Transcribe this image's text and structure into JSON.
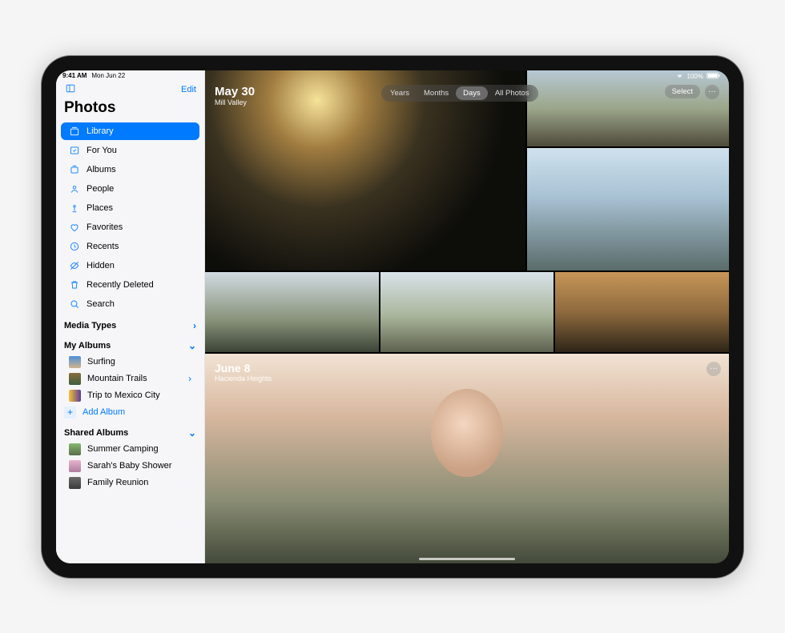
{
  "status": {
    "time": "9:41 AM",
    "date": "Mon Jun 22",
    "battery": "100%"
  },
  "topbar": {
    "edit": "Edit"
  },
  "app_title": "Photos",
  "nav": [
    {
      "label": "Library",
      "icon": "library-icon",
      "active": true
    },
    {
      "label": "For You",
      "icon": "for-you-icon"
    },
    {
      "label": "Albums",
      "icon": "albums-icon"
    },
    {
      "label": "People",
      "icon": "people-icon"
    },
    {
      "label": "Places",
      "icon": "places-icon"
    },
    {
      "label": "Favorites",
      "icon": "heart-icon"
    },
    {
      "label": "Recents",
      "icon": "clock-icon"
    },
    {
      "label": "Hidden",
      "icon": "eye-off-icon"
    },
    {
      "label": "Recently Deleted",
      "icon": "trash-icon"
    },
    {
      "label": "Search",
      "icon": "search-icon"
    }
  ],
  "sections": {
    "media_types": {
      "title": "Media Types"
    },
    "my_albums": {
      "title": "My Albums",
      "items": [
        "Surfing",
        "Mountain Trails",
        "Trip to Mexico City"
      ],
      "add": "Add Album"
    },
    "shared": {
      "title": "Shared Albums",
      "items": [
        "Summer Camping",
        "Sarah's Baby Shower",
        "Family Reunion"
      ]
    }
  },
  "segments": [
    "Years",
    "Months",
    "Days",
    "All Photos"
  ],
  "segment_selected": "Days",
  "actions": {
    "select": "Select"
  },
  "days": [
    {
      "date": "May 30",
      "location": "Mill Valley"
    },
    {
      "date": "June 8",
      "location": "Hacienda Heights"
    }
  ]
}
